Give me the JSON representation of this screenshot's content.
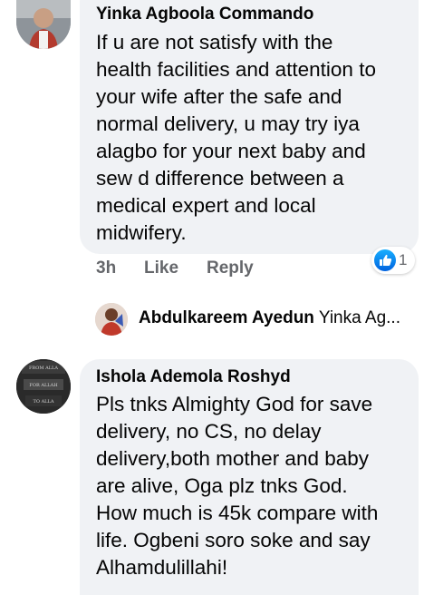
{
  "comments": [
    {
      "author": "Yinka Agboola Commando",
      "text": "If u are not satisfy with the\nhealth facilities and attention to\nyour wife after the safe and\nnormal delivery, u may try iya\nalagbo for your next baby and\nsew d difference between a\nmedical expert and local\nmidwifery.",
      "time": "3h",
      "like_label": "Like",
      "reply_label": "Reply",
      "reaction_count": "1",
      "reaction_icon": "like-icon"
    },
    {
      "author": "Ishola Ademola Roshyd",
      "text": "Pls tnks Almighty God for save\ndelivery, no CS, no delay\ndelivery,both mother and baby\nare alive, Oga plz tnks God.\nHow much is 45k compare with\nlife. Ogbeni soro soke and say\nAlhamdulillahi!"
    }
  ],
  "reply_preview": {
    "author": "Abdulkareem Ayedun",
    "snippet": "Yinka Ag..."
  },
  "avatar_images": {
    "ishola_avatar_text": [
      "FROM ALLA",
      "FOR ALLAH",
      "TO ALLA"
    ]
  },
  "colors": {
    "bubble_bg": "#f0f2f5",
    "meta_text": "#65676b",
    "like_blue": "#1877f2"
  }
}
